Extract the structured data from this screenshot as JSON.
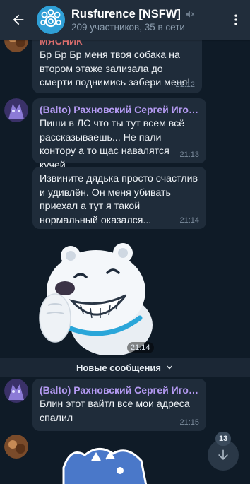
{
  "header": {
    "title": "Rusfurence [NSFW]",
    "subtitle": "209 участников, 35 в сети",
    "back_icon": "arrow-left-icon",
    "mute_icon": "muted-speaker-icon",
    "menu_icon": "more-vertical-icon"
  },
  "messages": [
    {
      "sender": "мясник",
      "text": "Бр Бр Бр меня твоя собака на втором этаже зализала до смерти поднимись забери меня!",
      "time": "21:12"
    },
    {
      "sender": "(Balto) Рахновский Сергей Игорев...",
      "text": "Пиши в ЛС что ты тут всем всё рассказываешь... Не пали контору а то щас навалятся кучей.",
      "time": "21:13"
    },
    {
      "text": "Извините дядька просто счастлив и удивлён. Он меня убивать приехал а тут я такой нормальный оказался...",
      "time": "21:14"
    },
    {
      "sticker": "polar-bear-sticker",
      "time": "21:14"
    },
    {
      "sender": "(Balto) Рахновский Сергей Игорев...",
      "text": "Блин этот вайтл все мои адреса спалил",
      "time": "21:15"
    }
  ],
  "divider": {
    "label": "Новые сообщения",
    "icon": "chevron-down-icon"
  },
  "scroll_button": {
    "badge": "13",
    "icon": "arrow-down-icon"
  },
  "colors": {
    "background": "#0f1b27",
    "header": "#212d3b",
    "bubble": "#1f2c3a",
    "sender": "#b49af2",
    "accent": "#2f9fd6"
  }
}
